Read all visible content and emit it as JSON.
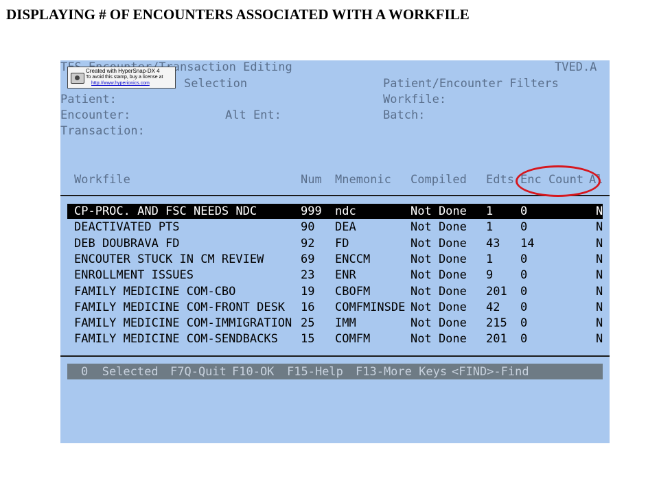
{
  "slide_title": "DISPLAYING # OF ENCOUNTERS ASSOCIATED WITH A WORKFILE",
  "terminal": {
    "title": "TFS Encounter/Transaction Editing",
    "screen_id": "TVED.A",
    "selection_label": "Selection",
    "filters_label": "Patient/Encounter Filters",
    "patient_label": "Patient:",
    "encounter_label": "Encounter:",
    "alt_ent_label": "Alt Ent:",
    "transaction_label": "Transaction:",
    "workfile_label": "Workfile:",
    "batch_label": "Batch:"
  },
  "stamp": {
    "line1": "Created with HyperSnap-DX 4",
    "line2": "To avoid this stamp, buy a license at",
    "line3": "http://www.hyperionics.com"
  },
  "columns": {
    "workfile": "Workfile",
    "num": "Num",
    "mnemonic": "Mnemonic",
    "compiled": "Compiled",
    "edts": "Edts",
    "enc_count": "Enc Count",
    "al": "Al"
  },
  "rows": [
    {
      "workfile": "CP-PROC. AND FSC NEEDS NDC",
      "num": "999",
      "mnemonic": "ndc",
      "compiled": "Not Done",
      "edts": "1",
      "enc_count": "0",
      "flag": "N"
    },
    {
      "workfile": "DEACTIVATED PTS",
      "num": "90",
      "mnemonic": "DEA",
      "compiled": "Not Done",
      "edts": "1",
      "enc_count": "0",
      "flag": "N"
    },
    {
      "workfile": "DEB DOUBRAVA FD",
      "num": "92",
      "mnemonic": "FD",
      "compiled": "Not Done",
      "edts": "43",
      "enc_count": "14",
      "flag": "N"
    },
    {
      "workfile": "ENCOUTER STUCK IN CM REVIEW",
      "num": "69",
      "mnemonic": "ENCCM",
      "compiled": "Not Done",
      "edts": "1",
      "enc_count": "0",
      "flag": "N"
    },
    {
      "workfile": "ENROLLMENT ISSUES",
      "num": "23",
      "mnemonic": "ENR",
      "compiled": "Not Done",
      "edts": "9",
      "enc_count": "0",
      "flag": "N"
    },
    {
      "workfile": "FAMILY MEDICINE COM-CBO",
      "num": "19",
      "mnemonic": "CBOFM",
      "compiled": "Not Done",
      "edts": "201",
      "enc_count": "0",
      "flag": "N"
    },
    {
      "workfile": "FAMILY MEDICINE COM-FRONT DESK",
      "num": "16",
      "mnemonic": "COMFMINSDE",
      "compiled": "Not Done",
      "edts": "42",
      "enc_count": "0",
      "flag": "N"
    },
    {
      "workfile": "FAMILY MEDICINE COM-IMMIGRATION",
      "num": "25",
      "mnemonic": "IMM",
      "compiled": "Not Done",
      "edts": "215",
      "enc_count": "0",
      "flag": "N"
    },
    {
      "workfile": "FAMILY MEDICINE COM-SENDBACKS",
      "num": "15",
      "mnemonic": "COMFM",
      "compiled": "Not Done",
      "edts": "201",
      "enc_count": "0",
      "flag": "N"
    }
  ],
  "status": {
    "selected": "0  Selected",
    "quit": "F7Q-Quit",
    "ok": "F10-OK",
    "help": "F15-Help",
    "more": "F13-More Keys",
    "find": "<FIND>-Find"
  }
}
